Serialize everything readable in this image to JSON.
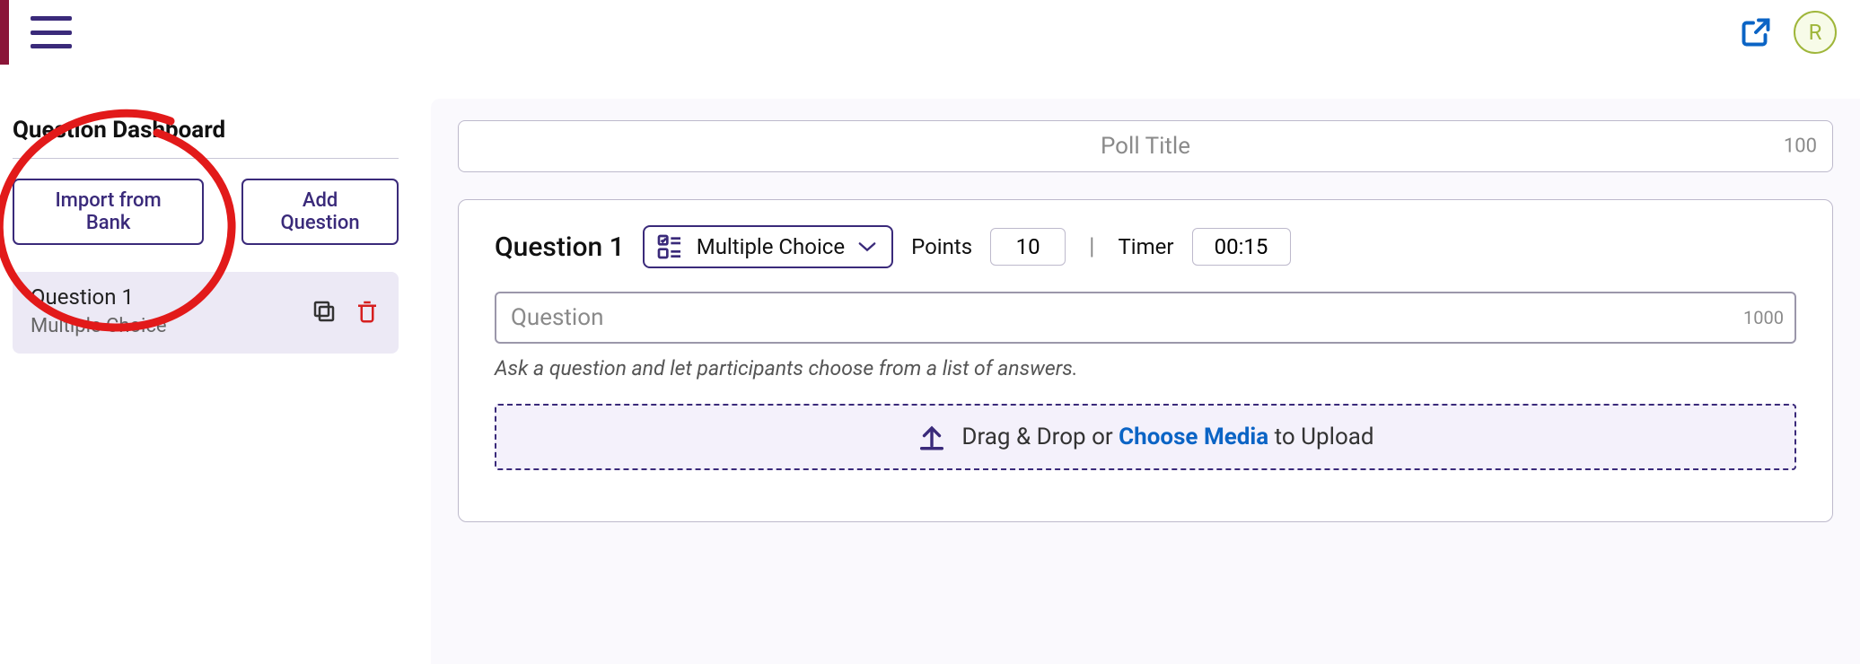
{
  "topbar": {
    "avatar_initial": "R"
  },
  "sidebar": {
    "heading": "Question Dashboard",
    "import_label": "Import from Bank",
    "add_label": "Add Question",
    "items": [
      {
        "title": "Question 1",
        "type": "Multiple Choice"
      }
    ]
  },
  "editor": {
    "poll_title_placeholder": "Poll Title",
    "poll_title_value": "",
    "poll_title_max": "100",
    "question": {
      "label": "Question 1",
      "type_label": "Multiple Choice",
      "points_label": "Points",
      "points_value": "10",
      "timer_label": "Timer",
      "timer_value": "00:15",
      "input_placeholder": "Question",
      "input_value": "",
      "input_max": "1000",
      "helper_text": "Ask a question and let participants choose from a list of answers.",
      "upload_prefix": "Drag & Drop or ",
      "upload_choose": "Choose Media",
      "upload_suffix": " to Upload"
    }
  }
}
